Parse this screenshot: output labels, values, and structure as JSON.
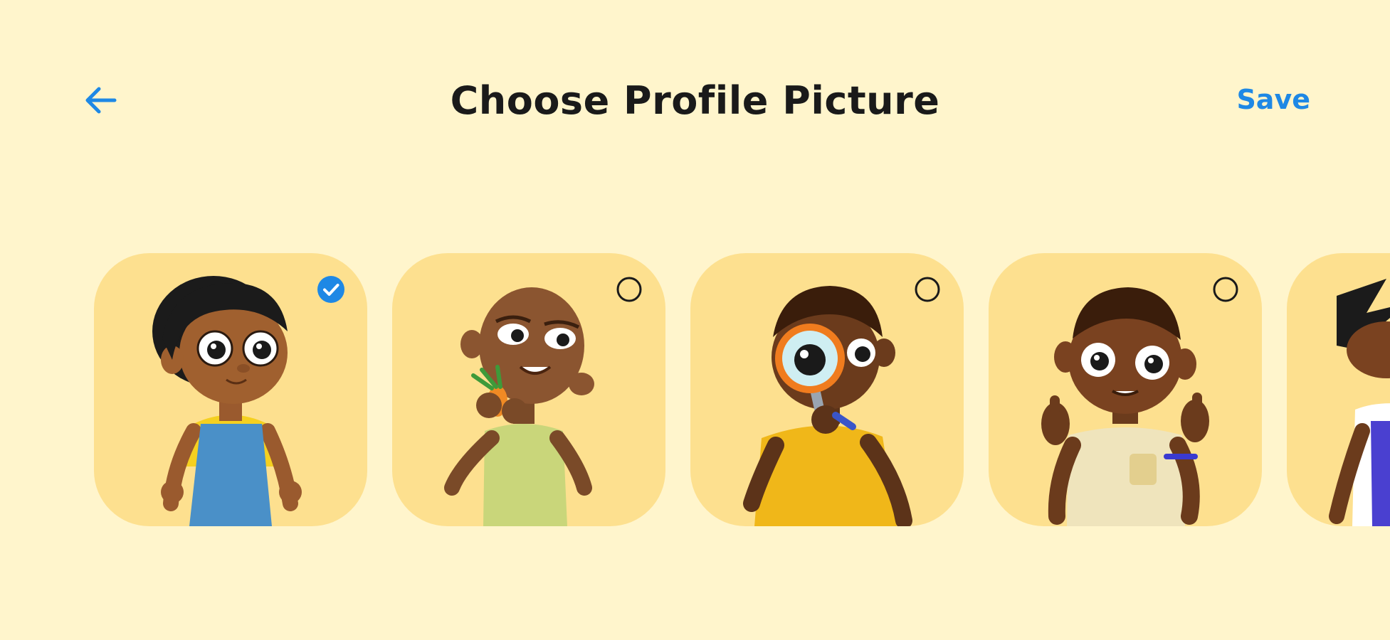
{
  "header": {
    "back_icon": "arrow-left-icon",
    "title": "Choose Profile Picture",
    "save_label": "Save"
  },
  "colors": {
    "background": "#fff5cc",
    "card": "#fde08f",
    "accent": "#1e88e5",
    "title": "#1a1a1a"
  },
  "avatars": [
    {
      "character": "girl-blue-overalls",
      "selected": true
    },
    {
      "character": "boy-holding-carrot",
      "selected": false
    },
    {
      "character": "boy-magnifying-glass",
      "selected": false
    },
    {
      "character": "boy-thumbs-up",
      "selected": false
    },
    {
      "character": "girl-purple-dress",
      "selected": false
    }
  ]
}
